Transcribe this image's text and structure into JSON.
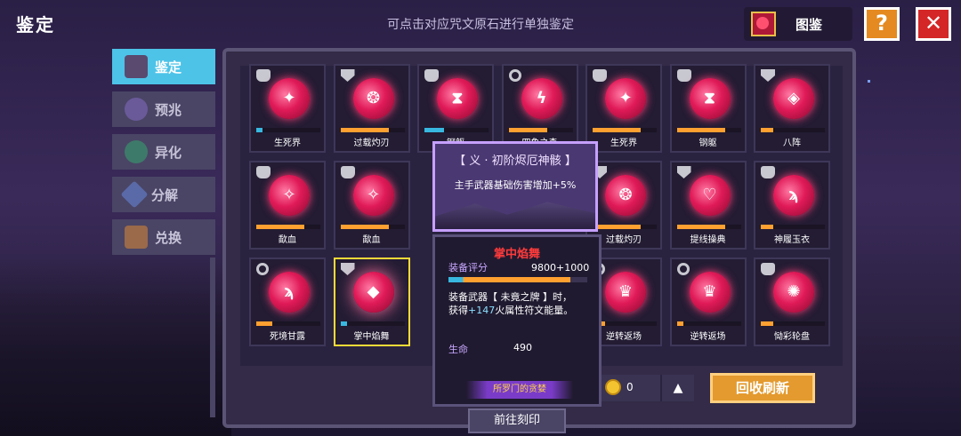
{
  "header": {
    "title": "鉴定",
    "hint": "可点击对应咒文原石进行单独鉴定",
    "codex_label": "图鉴",
    "help_label": "?",
    "close_label": "✕"
  },
  "sidebar": {
    "items": [
      {
        "label": "鉴定",
        "icon": "appraise-icon",
        "active": true
      },
      {
        "label": "预兆",
        "icon": "omen-icon",
        "active": false
      },
      {
        "label": "异化",
        "icon": "mutation-icon",
        "active": false
      },
      {
        "label": "分解",
        "icon": "decompose-icon",
        "active": false
      },
      {
        "label": "兑换",
        "icon": "exchange-icon",
        "active": false
      }
    ]
  },
  "grid": {
    "cards": [
      {
        "name": "生死界",
        "rune": "✦",
        "badge": "grey",
        "progress": 0.1,
        "bar_color": "#38b8e0",
        "row": 0,
        "col": 0
      },
      {
        "name": "过载灼刃",
        "rune": "❂",
        "badge": "shield",
        "progress": 0.75,
        "bar_color": "#ffa030",
        "row": 0,
        "col": 1
      },
      {
        "name": "钢躯",
        "rune": "⧗",
        "badge": "grey",
        "progress": 0.3,
        "bar_color": "#38b8e0",
        "row": 0,
        "col": 2
      },
      {
        "name": "四象之森",
        "rune": "ϟ",
        "badge": "ring",
        "progress": 0.6,
        "bar_color": "#ffa030",
        "row": 0,
        "col": 3
      },
      {
        "name": "生死界",
        "rune": "✦",
        "badge": "grey",
        "progress": 0.75,
        "bar_color": "#ffa030",
        "row": 0,
        "col": 4
      },
      {
        "name": "钢躯",
        "rune": "⧗",
        "badge": "grey",
        "progress": 0.75,
        "bar_color": "#ffa030",
        "row": 0,
        "col": 5
      },
      {
        "name": "八阵",
        "rune": "◈",
        "badge": "shield",
        "progress": 0.2,
        "bar_color": "#ffa030",
        "row": 0,
        "col": 6
      },
      {
        "name": "歃血",
        "rune": "✧",
        "badge": "grey",
        "progress": 0.75,
        "bar_color": "#ffa030",
        "row": 1,
        "col": 0
      },
      {
        "name": "歃血",
        "rune": "✧",
        "badge": "grey",
        "progress": 0.75,
        "bar_color": "#ffa030",
        "row": 1,
        "col": 1
      },
      {
        "name": "过载灼刃",
        "rune": "❂",
        "badge": "shield",
        "progress": 0.75,
        "bar_color": "#ffa030",
        "row": 1,
        "col": 4
      },
      {
        "name": "提线操典",
        "rune": "♡",
        "badge": "shield",
        "progress": 0.75,
        "bar_color": "#ffa030",
        "row": 1,
        "col": 5
      },
      {
        "name": "神履玉衣",
        "rune": "ϡ",
        "badge": "grey",
        "progress": 0.2,
        "bar_color": "#ffa030",
        "row": 1,
        "col": 6
      },
      {
        "name": "死境甘露",
        "rune": "ϡ",
        "badge": "ring",
        "progress": 0.25,
        "bar_color": "#ffa030",
        "row": 2,
        "col": 0
      },
      {
        "name": "掌中焰舞",
        "rune": "◆",
        "badge": "shield",
        "progress": 0.1,
        "bar_color": "#38b8e0",
        "row": 2,
        "col": 1,
        "selected": true
      },
      {
        "name": "逆转返场",
        "rune": "♛",
        "badge": "ring",
        "progress": 0.2,
        "bar_color": "#ffa030",
        "row": 2,
        "col": 4
      },
      {
        "name": "逆转返场",
        "rune": "♛",
        "badge": "ring",
        "progress": 0.1,
        "bar_color": "#ffa030",
        "row": 2,
        "col": 5
      },
      {
        "name": "恸彩轮盘",
        "rune": "✺",
        "badge": "grey",
        "progress": 0.2,
        "bar_color": "#ffa030",
        "row": 2,
        "col": 6
      }
    ]
  },
  "set_popup": {
    "title": "【 义 · 初阶烬厄神骸 】",
    "effect": "主手武器基础伤害增加+5%"
  },
  "detail_popup": {
    "name": "掌中焰舞",
    "score_label": "装备评分",
    "score_value": "9800+1000",
    "desc_1": "装备武器【 未竟之牌 】时，",
    "desc_2_prefix": "获得",
    "desc_2_highlight": "+147",
    "desc_2_suffix": "火属性符文能量。",
    "stat_label": "生命",
    "stat_value": "490",
    "set_name": "所罗门的贪婪"
  },
  "footer": {
    "go_label": "前往刻印",
    "coin_value": "0",
    "up_label": "▲",
    "recycle_label": "回收刷新"
  },
  "colors": {
    "accent": "#4dc3e8",
    "gold": "#ffdb38",
    "danger": "#d42626",
    "orange": "#e49a2e"
  }
}
